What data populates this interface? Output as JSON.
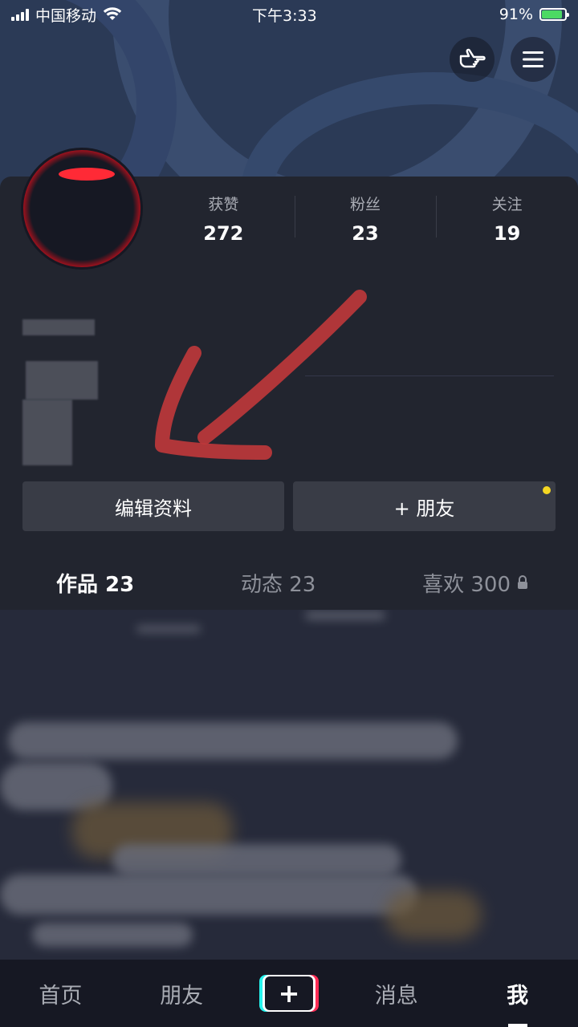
{
  "status_bar": {
    "carrier": "中国移动",
    "time": "下午3:33",
    "battery": "91%",
    "battery_level": 0.91
  },
  "stats": [
    {
      "label": "获赞",
      "value": "272"
    },
    {
      "label": "粉丝",
      "value": "23"
    },
    {
      "label": "关注",
      "value": "19"
    }
  ],
  "actions": {
    "edit_profile": "编辑资料",
    "add_friend": "+ 朋友"
  },
  "tabs": [
    {
      "label": "作品 23"
    },
    {
      "label": "动态 23"
    },
    {
      "label": "喜欢 300"
    }
  ],
  "bottom_nav": {
    "home": "首页",
    "friends": "朋友",
    "create": "+",
    "messages": "消息",
    "me": "我"
  },
  "colors": {
    "background": "#161823",
    "panel": "#22252f",
    "button": "#393c46",
    "arrow": "#c0393b",
    "notification_dot": "#f5d722"
  }
}
